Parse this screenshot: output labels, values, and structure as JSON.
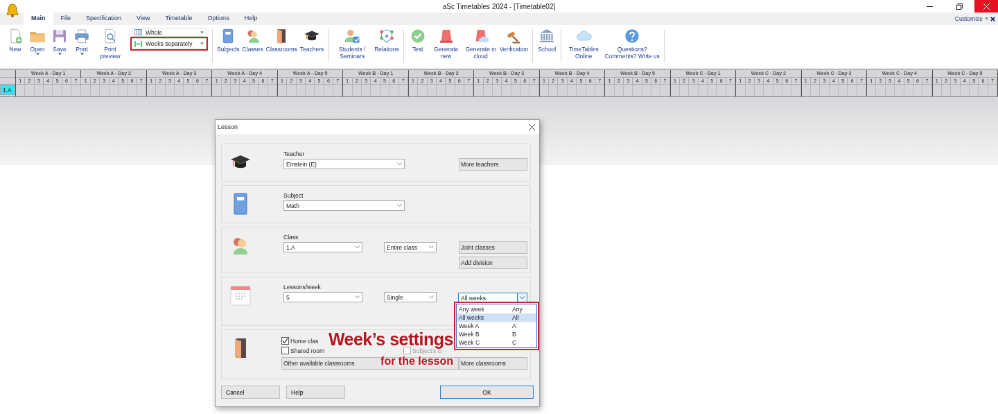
{
  "window": {
    "title": "aSc Timetables 2024  - [Timetable02]"
  },
  "ribbon": {
    "tabs": [
      {
        "label": "Main",
        "selected": true
      },
      {
        "label": "File",
        "selected": false
      },
      {
        "label": "Specification",
        "selected": false
      },
      {
        "label": "View",
        "selected": false
      },
      {
        "label": "Timetable",
        "selected": false
      },
      {
        "label": "Options",
        "selected": false
      },
      {
        "label": "Help",
        "selected": false
      }
    ],
    "customize": "Customize",
    "groups": [
      {
        "buttons": [
          {
            "kind": "new",
            "label": "New",
            "has_menu": false
          },
          {
            "kind": "open",
            "label": "Open",
            "has_menu": true
          },
          {
            "kind": "save",
            "label": "Save",
            "has_menu": true
          },
          {
            "kind": "print",
            "label": "Print",
            "has_menu": true
          },
          {
            "kind": "preview",
            "label": "Print preview",
            "has_menu": false
          }
        ],
        "combos": [
          {
            "kind": "whole",
            "value": "Whole",
            "highlighted": false
          },
          {
            "kind": "weeks",
            "value": "Weeks separately",
            "highlighted": true
          }
        ]
      },
      {
        "buttons": [
          {
            "kind": "subjects",
            "label": "Subjects",
            "has_menu": false
          },
          {
            "kind": "classes",
            "label": "Classes",
            "has_menu": false
          },
          {
            "kind": "classrooms",
            "label": "Classrooms",
            "has_menu": false
          },
          {
            "kind": "teachers",
            "label": "Teachers",
            "has_menu": false
          }
        ]
      },
      {
        "buttons": [
          {
            "kind": "students",
            "label": "Students / Seminars",
            "has_menu": false
          },
          {
            "kind": "relations",
            "label": "Relations",
            "has_menu": false
          }
        ]
      },
      {
        "buttons": [
          {
            "kind": "test",
            "label": "Test",
            "has_menu": false
          },
          {
            "kind": "generate",
            "label": "Generate new",
            "has_menu": false
          },
          {
            "kind": "cloud-generate",
            "label": "Generate in cloud",
            "has_menu": false
          },
          {
            "kind": "verification",
            "label": "Verification",
            "has_menu": false
          }
        ]
      },
      {
        "buttons": [
          {
            "kind": "school",
            "label": "School",
            "has_menu": false
          }
        ]
      },
      {
        "buttons": [
          {
            "kind": "online",
            "label": "TimeTables Online",
            "has_menu": false
          },
          {
            "kind": "questions",
            "label": "Questions? Comments? Write us",
            "has_menu": false
          }
        ]
      }
    ]
  },
  "grid": {
    "days": [
      {
        "label": "Week A - Day 1",
        "periods": [
          "1",
          "2",
          "3",
          "4",
          "5",
          "6",
          "7"
        ]
      },
      {
        "label": "Week A - Day 2",
        "periods": [
          "1",
          "2",
          "3",
          "4",
          "5",
          "6",
          "7"
        ]
      },
      {
        "label": "Week A - Day 3",
        "periods": [
          "1",
          "2",
          "3",
          "4",
          "5",
          "6",
          "7"
        ]
      },
      {
        "label": "Week A - Day 4",
        "periods": [
          "1",
          "2",
          "3",
          "4",
          "5",
          "6",
          "7"
        ]
      },
      {
        "label": "Week A - Day 5",
        "periods": [
          "1",
          "2",
          "3",
          "4",
          "5",
          "6",
          "7"
        ]
      },
      {
        "label": "Week B - Day 1",
        "periods": [
          "1",
          "2",
          "3",
          "4",
          "5",
          "6",
          "7"
        ]
      },
      {
        "label": "Week B - Day 2",
        "periods": [
          "1",
          "2",
          "3",
          "4",
          "5",
          "6",
          "7"
        ]
      },
      {
        "label": "Week B - Day 3",
        "periods": [
          "1",
          "2",
          "3",
          "4",
          "5",
          "6",
          "7"
        ]
      },
      {
        "label": "Week B - Day 4",
        "periods": [
          "1",
          "2",
          "3",
          "4",
          "5",
          "6",
          "7"
        ]
      },
      {
        "label": "Week B - Day 5",
        "periods": [
          "1",
          "2",
          "3",
          "4",
          "5",
          "6",
          "7"
        ]
      },
      {
        "label": "Week C - Day 1",
        "periods": [
          "1",
          "2",
          "3",
          "4",
          "5",
          "6",
          "7"
        ]
      },
      {
        "label": "Week C - Day 2",
        "periods": [
          "1",
          "2",
          "3",
          "4",
          "5",
          "6",
          "7"
        ]
      },
      {
        "label": "Week C - Day 3",
        "periods": [
          "1",
          "2",
          "3",
          "4",
          "5",
          "6",
          "7"
        ]
      },
      {
        "label": "Week C - Day 4",
        "periods": [
          "1",
          "2",
          "3",
          "4",
          "5",
          "6",
          "7"
        ]
      },
      {
        "label": "Week C - Day 5",
        "periods": [
          "1",
          "2",
          "3",
          "4",
          "5",
          "6",
          "7"
        ]
      }
    ],
    "rows": [
      {
        "label": "1.A",
        "selected": true
      }
    ]
  },
  "dialog": {
    "title": "Lesson",
    "teacher": {
      "label": "Teacher",
      "value": "Einstein (E)",
      "button": "More teachers"
    },
    "subject": {
      "label": "Subject",
      "value": "Math"
    },
    "class": {
      "label": "Class",
      "value": "1.A",
      "division": "Entire class",
      "buttons": [
        "Joint classes",
        "Add division"
      ]
    },
    "lessons": {
      "label": "Lessons/week",
      "value": "5",
      "length": "Single",
      "weeks": "All weeks",
      "week_list": {
        "highlighted": true,
        "options": [
          {
            "label": "Any week",
            "code": "Any",
            "selected": false
          },
          {
            "label": "All weeks",
            "code": "All",
            "selected": true
          },
          {
            "label": "Week A",
            "code": "A",
            "selected": false
          },
          {
            "label": "Week B",
            "code": "B",
            "selected": false
          },
          {
            "label": "Week C",
            "code": "C",
            "selected": false
          }
        ]
      }
    },
    "classroom": {
      "checks": [
        {
          "label": "Home clas",
          "checked": true,
          "disabled": false
        },
        {
          "label": "Shared room",
          "checked": false,
          "disabled": false
        },
        {
          "label": "Subject's cl",
          "checked": false,
          "disabled": true
        }
      ],
      "other": "Other available classrooms",
      "more": "More classrooms"
    },
    "buttons": [
      {
        "kind": "plain",
        "label": "Cancel"
      },
      {
        "kind": "plain",
        "label": "Help"
      },
      {
        "kind": "default",
        "label": "OK"
      }
    ]
  },
  "annotation": {
    "headline": "Week’s settings",
    "subline": "for the lesson"
  }
}
